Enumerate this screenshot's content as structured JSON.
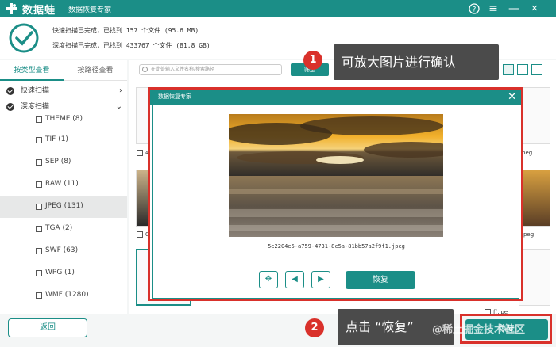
{
  "titlebar": {
    "brand": "数据蛙",
    "product": "数据恢复专家",
    "help": "?",
    "menu": "≡",
    "minimize": "—",
    "close": "✕"
  },
  "status": {
    "quick_scan": "快速扫描已完成，已找到 157 个文件 (95.6 MB)",
    "deep_scan": "深度扫描已完成，已找到 433767 个文件 (81.8 GB)"
  },
  "left_tabs": [
    "按类型查看",
    "按路径查看"
  ],
  "tree": {
    "quick": "快速扫描",
    "deep": "深度扫描"
  },
  "file_types": [
    {
      "label": "THEME (8)"
    },
    {
      "label": "TIF (1)"
    },
    {
      "label": "SEP (8)"
    },
    {
      "label": "RAW (11)"
    },
    {
      "label": "JPEG (131)"
    },
    {
      "label": "TGA (2)"
    },
    {
      "label": "SWF (63)"
    },
    {
      "label": "WPG (1)"
    },
    {
      "label": "WMF (1280)"
    }
  ],
  "toolbar": {
    "search_placeholder": "在此处输入文件名称/搜索路径",
    "search_button": "筛选"
  },
  "grid_labels": {
    "row1_first": "4",
    "row1_last": "peg",
    "row2_first": "0",
    "row2_last": "jpeg",
    "row3_last": "f(.jpe"
  },
  "dialog": {
    "title": "数据恢复专家",
    "close": "✕",
    "filename": "5e2204e5-a759-4731-8c5a-81bb57a2f9f1.jpeg",
    "recover": "恢复"
  },
  "bottom": {
    "back": "返回",
    "recover": "恢复"
  },
  "callouts": {
    "step1_num": "1",
    "step1_text": "可放大图片进行确认",
    "step2_num": "2",
    "step2_text": "点击 “恢复”"
  },
  "watermark": "@稀土掘金技术社区",
  "colors": {
    "accent": "#1b8e87",
    "highlight": "#d9312b",
    "callout_bg": "#4b4b4b"
  }
}
